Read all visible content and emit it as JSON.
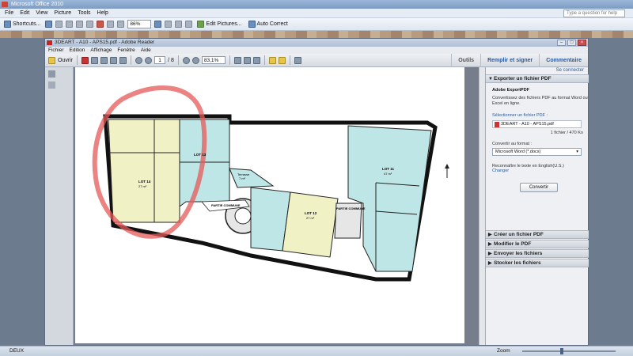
{
  "office": {
    "title": "Microsoft Office 2010",
    "menu": [
      "File",
      "Edit",
      "View",
      "Picture",
      "Tools",
      "Help"
    ],
    "help_placeholder": "Type a question for help",
    "toolbar": {
      "shortcuts": "Shortcuts...",
      "zoom": "86%",
      "edit_pictures": "Edit Pictures...",
      "auto_correct": "Auto Correct"
    }
  },
  "acrobat": {
    "title": "3DEART - A10 - APS15.pdf - Adobe Reader",
    "menu": [
      "Fichier",
      "Edition",
      "Affichage",
      "Fenêtre",
      "Aide"
    ],
    "toolbar": {
      "open": "Ouvrir",
      "page_current": "1",
      "page_total": "/ 8",
      "zoom": "83,1%"
    },
    "tabs": [
      "Outils",
      "Remplir et signer",
      "Commentaire"
    ]
  },
  "side_pane": {
    "connect": "Se connecter",
    "export_header": "Exporter un fichier PDF",
    "service_name": "Adobe ExportPDF",
    "service_desc": [
      "Convertissez des fichiers PDF au format Word ou",
      "Excel en ligne."
    ],
    "select_label": "Sélectionner un fichier PDF :",
    "file_name": "3DEART - A10 - APS15.pdf",
    "file_count": "1 fichier / 470 Ko",
    "convert_to_label": "Convertir au format :",
    "format_value": "Microsoft Word (*.docx)",
    "recognize_text": "Reconnaître le texte en English(U.S.)",
    "change_link": "Changer",
    "convert_button": "Convertir",
    "sections": [
      "Créer un fichier PDF",
      "Modifier le PDF",
      "Envoyer les fichiers",
      "Stocker les fichiers"
    ]
  },
  "plan": {
    "labels": {
      "lot14": "LOT 14",
      "lot14_area": "27 m²",
      "lot13": "LOT 13",
      "lot12": "LOT 12",
      "lot12_area": "27 m²",
      "lot11": "LOT 11",
      "lot11_area": "47 m²",
      "partie_commune_1": "PARTIE COMMUNE",
      "partie_commune_2": "PARTIE COMMUNE",
      "terrasse": "Terrasse",
      "terrasse_area": "7 m²"
    }
  },
  "status": {
    "left": "DEUX",
    "zoom_label": "Zoom"
  }
}
